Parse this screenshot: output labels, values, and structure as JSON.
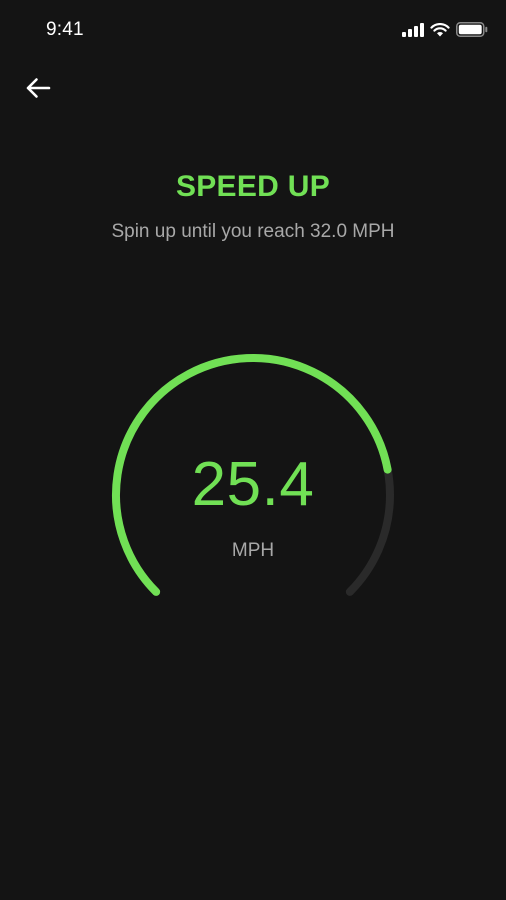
{
  "status_bar": {
    "time": "9:41",
    "icons": [
      "cellular-signal-icon",
      "wifi-icon",
      "battery-icon"
    ]
  },
  "header": {
    "back_icon": "arrow-left-icon"
  },
  "main": {
    "title": "SPEED UP",
    "subtitle": "Spin up until you reach 32.0 MPH",
    "gauge": {
      "value": "25.4",
      "unit": "MPH",
      "target": 32.0,
      "current": 25.4
    }
  },
  "colors": {
    "background": "#141414",
    "accent": "#71e055",
    "track": "#2a2a2a",
    "muted_text": "#a8a8a8"
  }
}
